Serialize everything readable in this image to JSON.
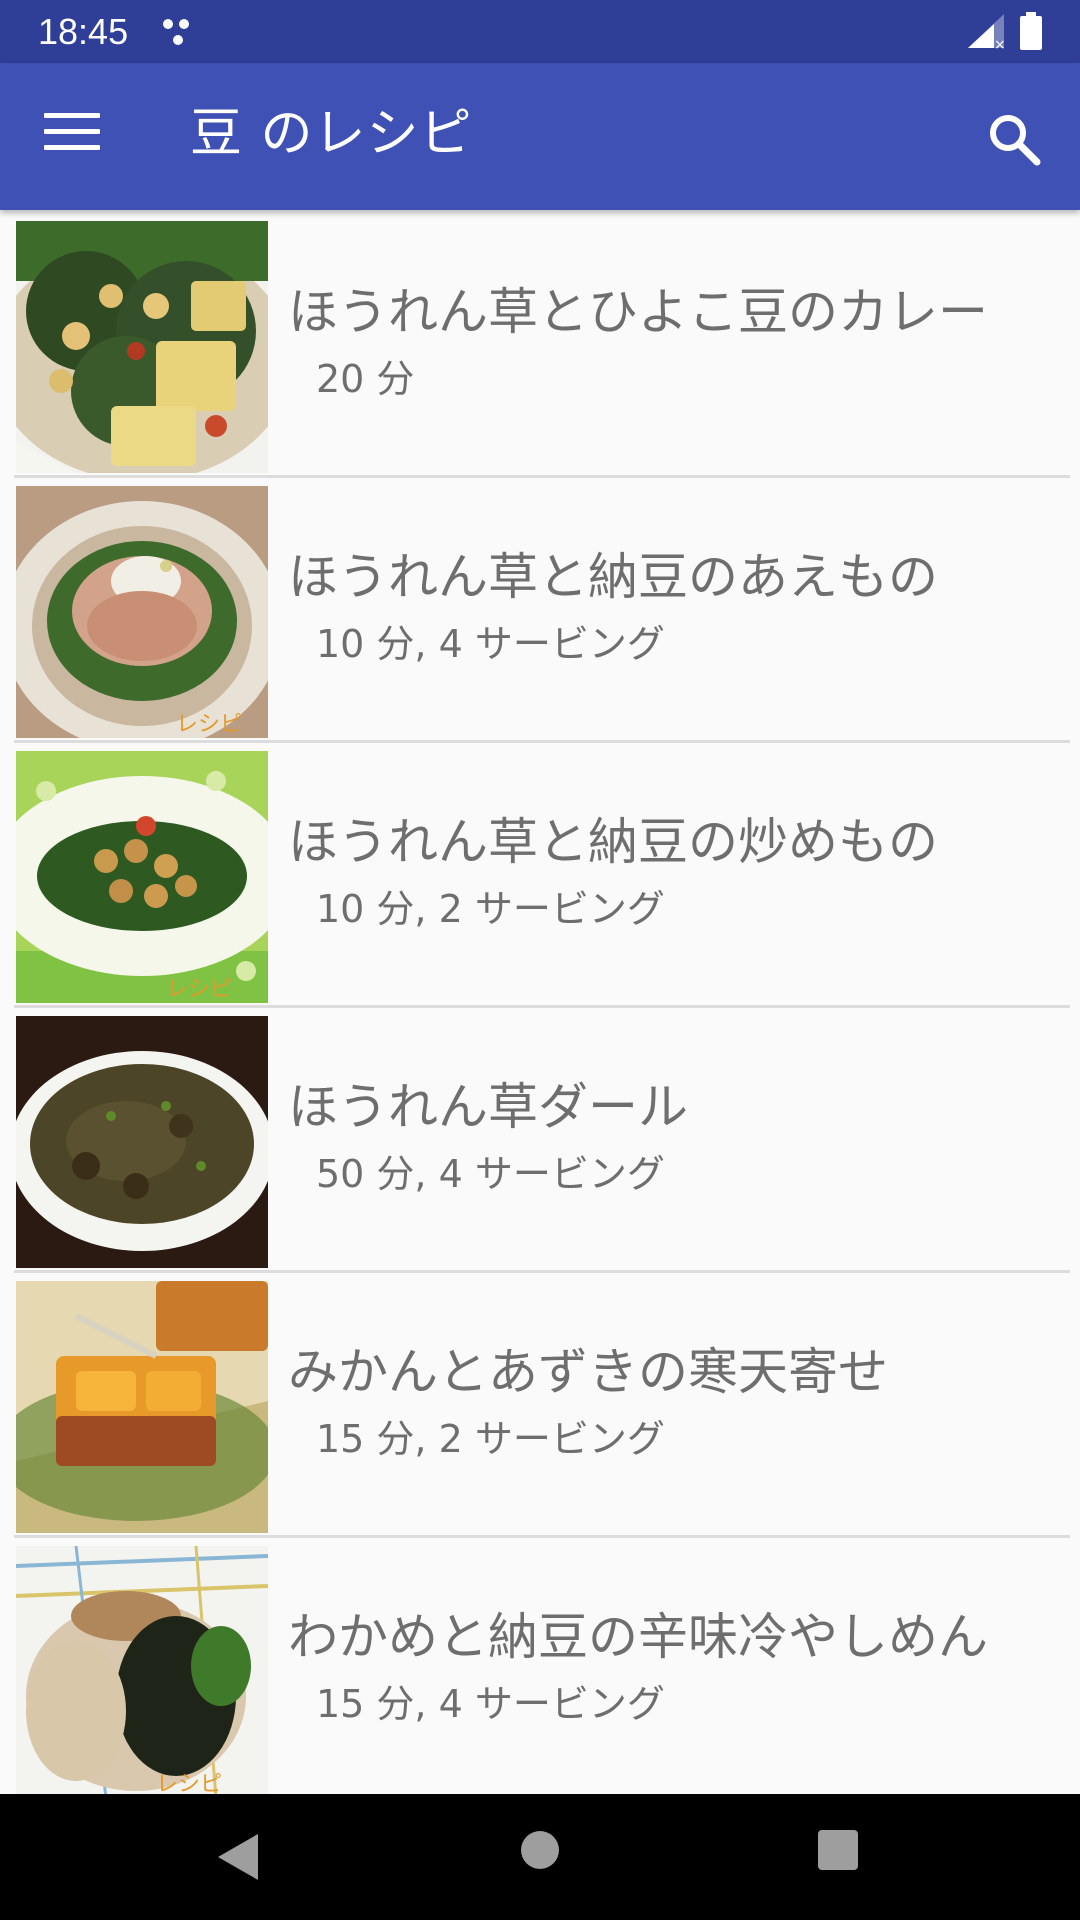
{
  "status_bar": {
    "time": "18:45",
    "icons": [
      "notification-dots-icon",
      "signal-icon",
      "battery-icon"
    ]
  },
  "app_bar": {
    "title": "豆 のレシピ",
    "menu_icon": "menu-icon",
    "search_icon": "search-icon",
    "color": "#3f51b5",
    "status_color": "#2f3f98"
  },
  "recipes": [
    {
      "title": "ほうれん草とひよこ豆のカレー",
      "meta": "20 分",
      "image": "spinach-chickpea-curry-photo"
    },
    {
      "title": "ほうれん草と納豆のあえもの",
      "meta": "10 分, 4 サービング",
      "image": "spinach-natto-aemono-photo"
    },
    {
      "title": "ほうれん草と納豆の炒めもの",
      "meta": "10 分, 2 サービング",
      "image": "spinach-natto-stirfry-photo"
    },
    {
      "title": "ほうれん草ダール",
      "meta": "50 分, 4 サービング",
      "image": "spinach-dal-photo"
    },
    {
      "title": "みかんとあずきの寒天寄せ",
      "meta": "15 分, 2 サービング",
      "image": "mikan-azuki-kanten-photo"
    },
    {
      "title": "わかめと納豆の辛味冷やしめん",
      "meta": "15 分, 4 サービング",
      "image": "wakame-natto-noodles-photo"
    }
  ],
  "nav_bar": {
    "icons": [
      "back-icon",
      "home-icon",
      "recents-icon"
    ]
  }
}
